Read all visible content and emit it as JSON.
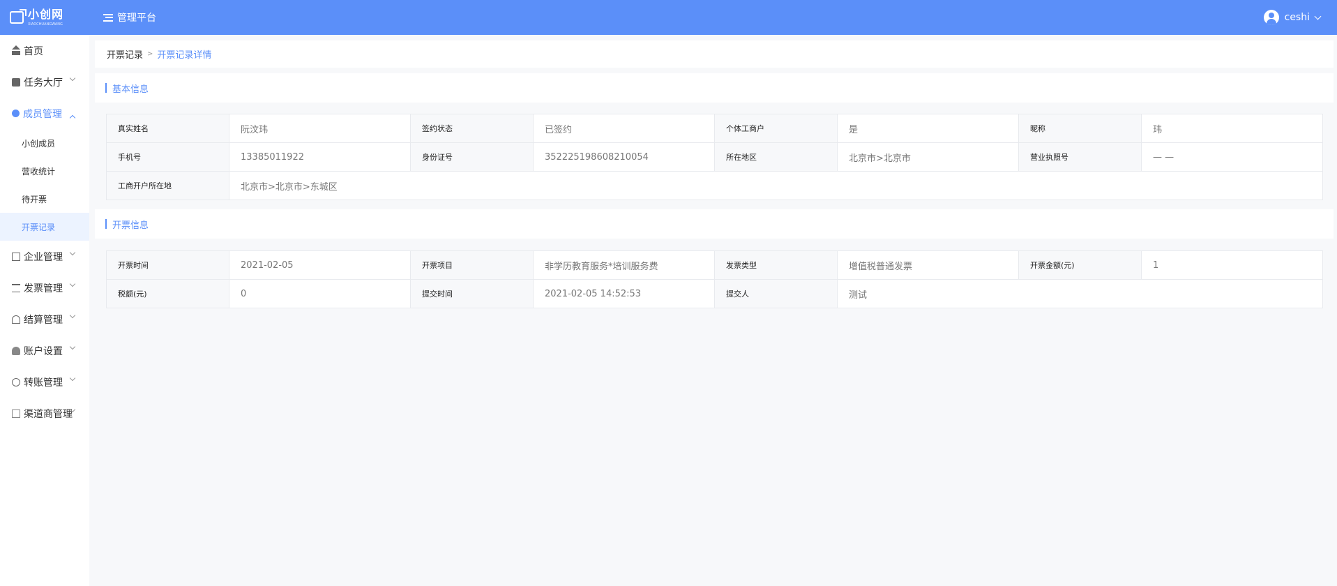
{
  "header": {
    "logo_text": "小创网",
    "logo_sub": "XIAOCHUANGWANG",
    "platform_label": "管理平台",
    "username": "ceshi"
  },
  "sidebar": {
    "items": [
      {
        "label": "首页",
        "icon": "home-icon"
      },
      {
        "label": "任务大厅",
        "icon": "task-icon"
      },
      {
        "label": "成员管理",
        "icon": "member-icon",
        "sub": [
          "小创成员",
          "营收统计",
          "待开票",
          "开票记录"
        ]
      },
      {
        "label": "企业管理",
        "icon": "building-icon"
      },
      {
        "label": "发票管理",
        "icon": "invoice-icon"
      },
      {
        "label": "结算管理",
        "icon": "settlement-icon"
      },
      {
        "label": "账户设置",
        "icon": "account-icon"
      },
      {
        "label": "转账管理",
        "icon": "transfer-icon"
      },
      {
        "label": "渠道商管理",
        "icon": "channel-icon"
      }
    ]
  },
  "breadcrumb": {
    "parent": "开票记录",
    "separator": ">",
    "current": "开票记录详情"
  },
  "basic": {
    "title": "基本信息",
    "rows": [
      [
        [
          "真实姓名",
          "阮汶玮"
        ],
        [
          "签约状态",
          "已签约"
        ],
        [
          "个体工商户",
          "是"
        ],
        [
          "昵称",
          "玮"
        ]
      ],
      [
        [
          "手机号",
          "13385011922"
        ],
        [
          "身份证号",
          "352225198608210054"
        ],
        [
          "所在地区",
          "北京市>北京市"
        ],
        [
          "营业执照号",
          "— —"
        ]
      ],
      [
        [
          "工商开户所在地",
          "北京市>北京市>东城区"
        ]
      ]
    ]
  },
  "invoice": {
    "title": "开票信息",
    "rows": [
      [
        [
          "开票时间",
          "2021-02-05"
        ],
        [
          "开票项目",
          "非学历教育服务*培训服务费"
        ],
        [
          "发票类型",
          "增值税普通发票"
        ],
        [
          "开票金额(元)",
          "1"
        ]
      ],
      [
        [
          "税额(元)",
          "0"
        ],
        [
          "提交时间",
          "2021-02-05 14:52:53"
        ],
        [
          "提交人",
          "测试"
        ]
      ]
    ]
  },
  "colors": {
    "primary": "#5b8ff9",
    "header_bg": "#5b8ff9",
    "page_bg": "#f7f8fa"
  }
}
